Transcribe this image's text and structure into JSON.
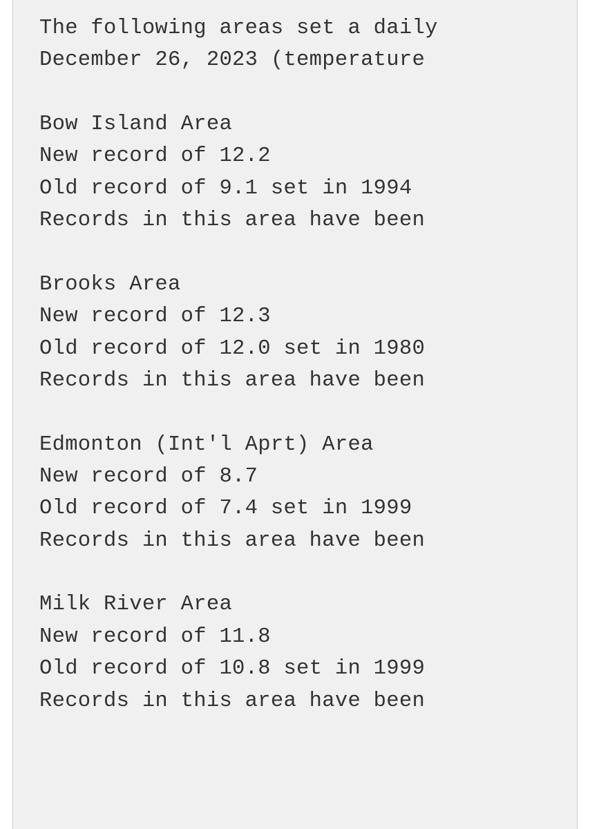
{
  "header": {
    "line1": "The following areas set a daily",
    "line2": "December 26, 2023 (temperature"
  },
  "areas": [
    {
      "name": "Bow Island Area",
      "new_record": "New record of 12.2",
      "old_record": "Old record of 9.1 set in 1994",
      "note": "Records in this area have been"
    },
    {
      "name": "Brooks Area",
      "new_record": "New record of 12.3",
      "old_record": "Old record of 12.0 set in 1980",
      "note": "Records in this area have been"
    },
    {
      "name": "Edmonton (Int'l Aprt) Area",
      "new_record": "New record of 8.7",
      "old_record": "Old record of 7.4 set in 1999",
      "note": "Records in this area have been"
    },
    {
      "name": "Milk River Area",
      "new_record": "New record of 11.8",
      "old_record": "Old record of 10.8 set in 1999",
      "note": "Records in this area have been"
    }
  ]
}
